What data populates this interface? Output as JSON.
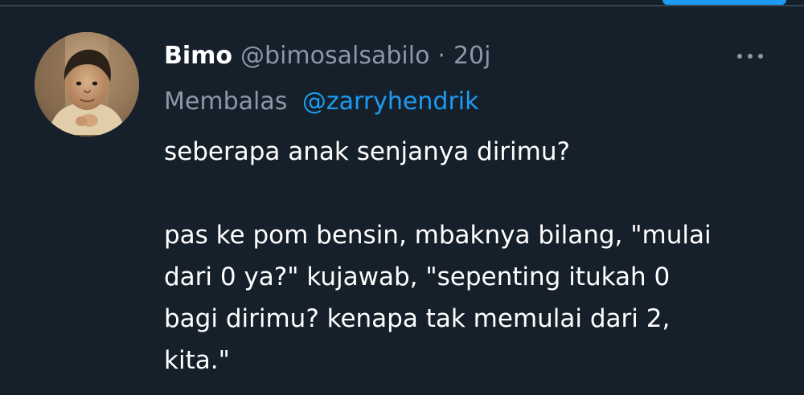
{
  "author": {
    "display_name": "Bimo",
    "handle": "@bimosalsabilo",
    "separator": "·",
    "timestamp": "20j",
    "avatar_icon": "profile-photo-icon"
  },
  "reply": {
    "prefix": "Membalas",
    "mention": "@zarryhendrik"
  },
  "tweet": {
    "line_1": "seberapa anak senjanya dirimu?",
    "line_2": "pas ke pom bensin, mbaknya bilang, \"mulai",
    "line_3": "dari 0 ya?\" kujawab, \"sepenting itukah 0",
    "line_4": "bagi dirimu? kenapa tak memulai dari 2,",
    "line_5": "kita.\""
  },
  "menu": {
    "more_icon": "more-horizontal-icon"
  },
  "colors": {
    "background": "#15202b",
    "primary_text": "#ffffff",
    "secondary_text": "#8b98a5",
    "accent": "#1d9bf0",
    "divider": "#38444d"
  }
}
